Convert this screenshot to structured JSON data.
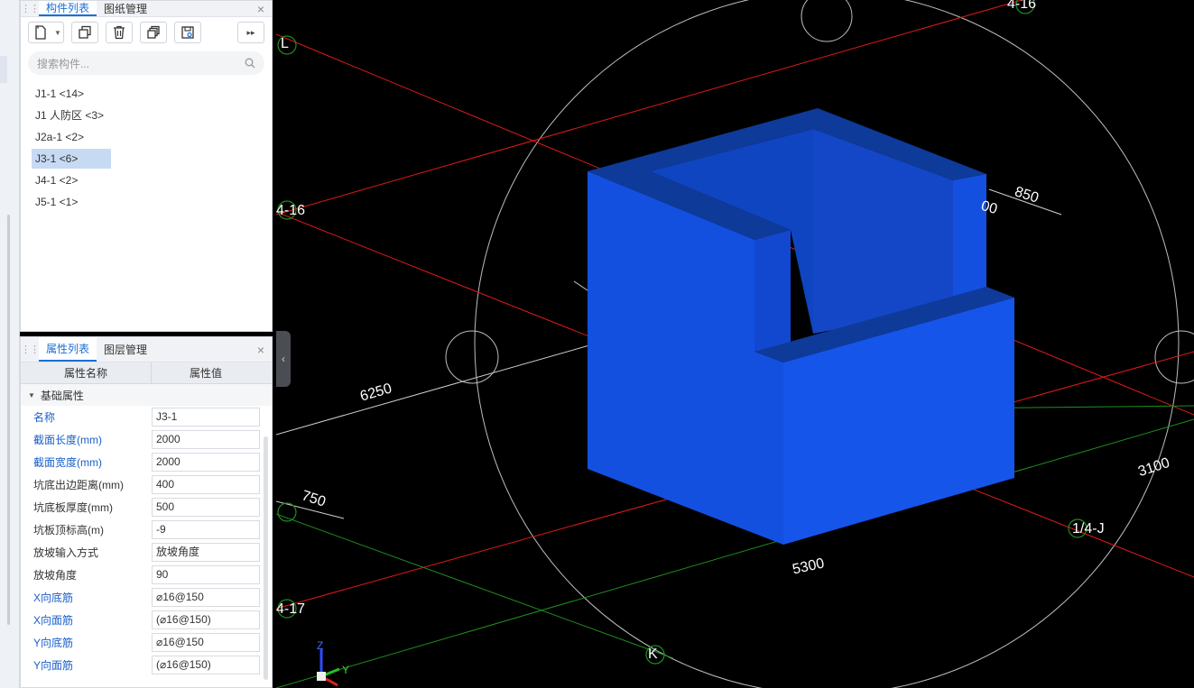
{
  "component_panel": {
    "tabs": [
      "构件列表",
      "图纸管理"
    ],
    "search_placeholder": "搜索构件...",
    "items": [
      "J1-1 <14>",
      "J1 人防区 <3>",
      "J2a-1 <2>",
      "J3-1 <6>",
      "J4-1 <2>",
      "J5-1 <1>"
    ],
    "selected_index": 3
  },
  "property_panel": {
    "tabs": [
      "属性列表",
      "图层管理"
    ],
    "col_name": "属性名称",
    "col_value": "属性值",
    "group": "基础属性",
    "rows": [
      {
        "name": "名称",
        "value": "J3-1"
      },
      {
        "name": "截面长度(mm)",
        "value": "2000"
      },
      {
        "name": "截面宽度(mm)",
        "value": "2000"
      },
      {
        "name": "坑底出边距离(mm)",
        "value": "400"
      },
      {
        "name": "坑底板厚度(mm)",
        "value": "500"
      },
      {
        "name": "坑板顶标高(m)",
        "value": "-9"
      },
      {
        "name": "放坡输入方式",
        "value": "放坡角度"
      },
      {
        "name": "放坡角度",
        "value": "90"
      },
      {
        "name": "X向底筋",
        "value": "⌀16@150"
      },
      {
        "name": "X向面筋",
        "value": "(⌀16@150)"
      },
      {
        "name": "Y向底筋",
        "value": "⌀16@150"
      },
      {
        "name": "Y向面筋",
        "value": "(⌀16@150)"
      }
    ]
  },
  "viewport": {
    "labels": {
      "axis_L": "L",
      "axis_4_16_top": "4-16",
      "axis_4_16_left": "4-16",
      "axis_4_17": "4-17",
      "axis_K": "K",
      "axis_1_4_J": "1/4-J",
      "dim_850": "850",
      "dim_00": "00",
      "dim_6250": "6250",
      "dim_750": "750",
      "dim_5300": "5300",
      "dim_3100": "3100"
    },
    "axis_z": "Z",
    "axis_y": "Y",
    "model_color": "#1450e0"
  }
}
